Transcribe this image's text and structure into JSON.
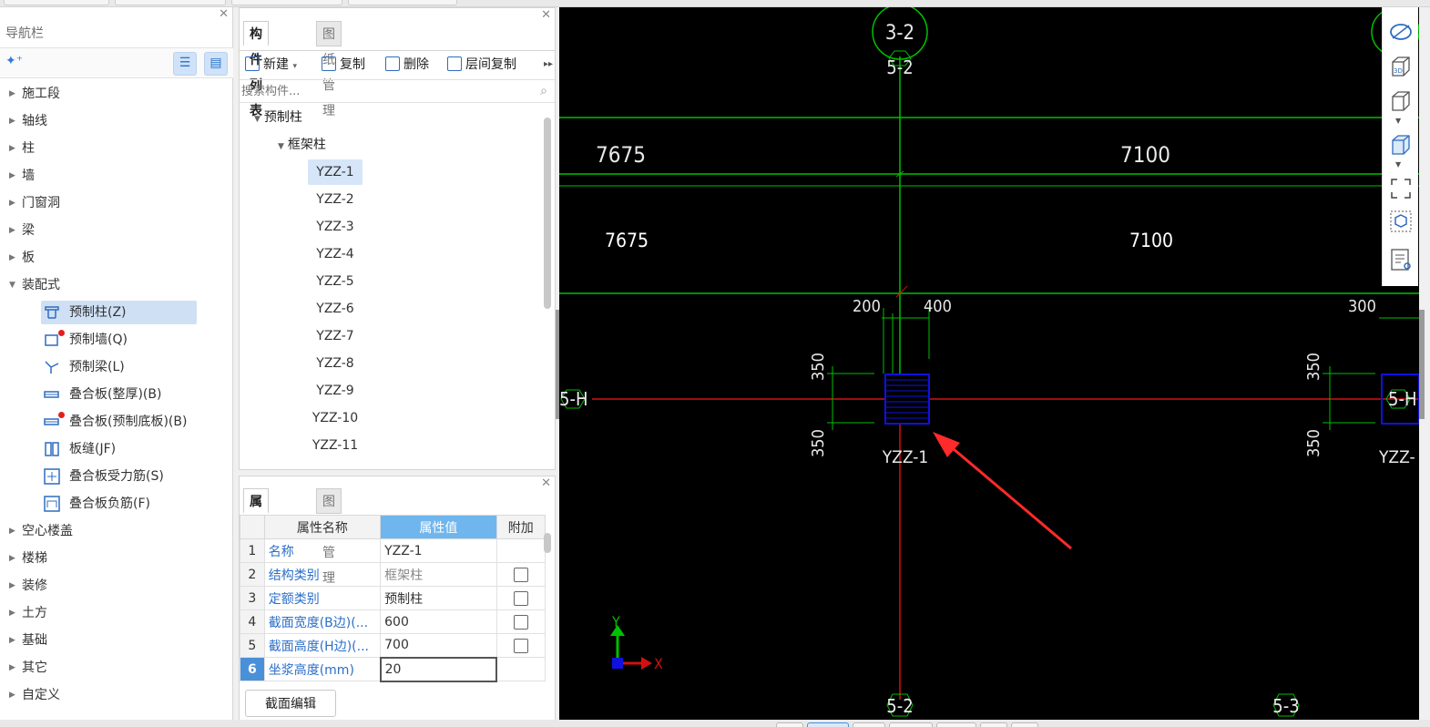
{
  "nav": {
    "title": "导航栏",
    "items": [
      {
        "label": "施工段"
      },
      {
        "label": "轴线"
      },
      {
        "label": "柱"
      },
      {
        "label": "墙"
      },
      {
        "label": "门窗洞"
      },
      {
        "label": "梁"
      },
      {
        "label": "板"
      },
      {
        "label": "装配式"
      }
    ],
    "sub_items": [
      {
        "label": "预制柱(Z)"
      },
      {
        "label": "预制墙(Q)"
      },
      {
        "label": "预制梁(L)"
      },
      {
        "label": "叠合板(整厚)(B)"
      },
      {
        "label": "叠合板(预制底板)(B)"
      },
      {
        "label": "板缝(JF)"
      },
      {
        "label": "叠合板受力筋(S)"
      },
      {
        "label": "叠合板负筋(F)"
      }
    ],
    "items_after": [
      {
        "label": "空心楼盖"
      },
      {
        "label": "楼梯"
      },
      {
        "label": "装修"
      },
      {
        "label": "土方"
      },
      {
        "label": "基础"
      },
      {
        "label": "其它"
      },
      {
        "label": "自定义"
      }
    ]
  },
  "component_panel": {
    "tabs": [
      "构件列表",
      "图纸管理"
    ],
    "toolbar": {
      "new": "新建",
      "copy": "复制",
      "delete": "删除",
      "floor_copy": "层间复制"
    },
    "search_placeholder": "搜索构件...",
    "tree_root": "预制柱",
    "tree_child": "框架柱",
    "leaves": [
      "YZZ-1",
      "YZZ-2",
      "YZZ-3",
      "YZZ-4",
      "YZZ-5",
      "YZZ-6",
      "YZZ-7",
      "YZZ-8",
      "YZZ-9",
      "YZZ-10",
      "YZZ-11"
    ],
    "selected": "YZZ-1"
  },
  "property_panel": {
    "tabs": [
      "属性列表",
      "图层管理"
    ],
    "headers": {
      "name": "属性名称",
      "value": "属性值",
      "extra": "附加"
    },
    "rows": [
      {
        "num": "1",
        "name": "名称",
        "value": "YZZ-1"
      },
      {
        "num": "2",
        "name": "结构类别",
        "value": "框架柱"
      },
      {
        "num": "3",
        "name": "定额类别",
        "value": "预制柱"
      },
      {
        "num": "4",
        "name": "截面宽度(B边)(...",
        "value": "600"
      },
      {
        "num": "5",
        "name": "截面高度(H边)(...",
        "value": "700"
      },
      {
        "num": "6",
        "name": "坐浆高度(mm)",
        "value": "20"
      }
    ],
    "edit_button": "截面编辑"
  },
  "canvas": {
    "axis_top": "3-2",
    "axis_top_small": "5-2",
    "axis_bottom": "5-2",
    "axis_bottom_right": "5-3",
    "axis_left": "5-H",
    "axis_right": "5-H",
    "dim_top_left": "7675",
    "dim_top_right": "7100",
    "dim_mid_left": "7675",
    "dim_mid_right": "7100",
    "dim_200": "200",
    "dim_400": "400",
    "dim_300": "300",
    "dim_350_a": "350",
    "dim_350_b": "350",
    "dim_350_c": "350",
    "dim_350_d": "350",
    "column_label": "YZZ-1",
    "column_label_right": "YZZ-",
    "ucs_y": "Y",
    "ucs_x": "X",
    "colors": {
      "grid": "#00c000",
      "axis_red": "#d21010",
      "column": "#1010e0",
      "arrow": "#ff2a2a"
    }
  }
}
